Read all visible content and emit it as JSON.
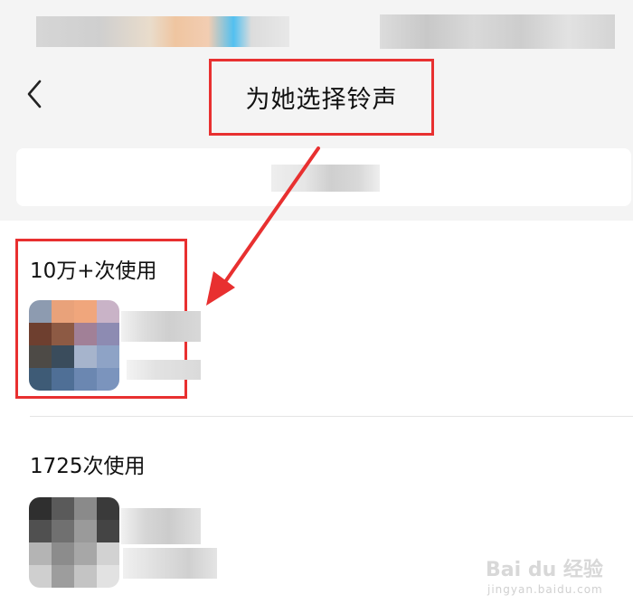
{
  "header": {
    "back_icon": "chevron-left-icon",
    "title": "为她选择铃声"
  },
  "ringtones": [
    {
      "usage": "10万+次使用"
    },
    {
      "usage": "1725次使用"
    }
  ],
  "watermark": {
    "brand": "Bai du 经验",
    "url": "jingyan.baidu.com"
  },
  "colors": {
    "highlight": "#e83030",
    "background": "#f4f4f4"
  }
}
